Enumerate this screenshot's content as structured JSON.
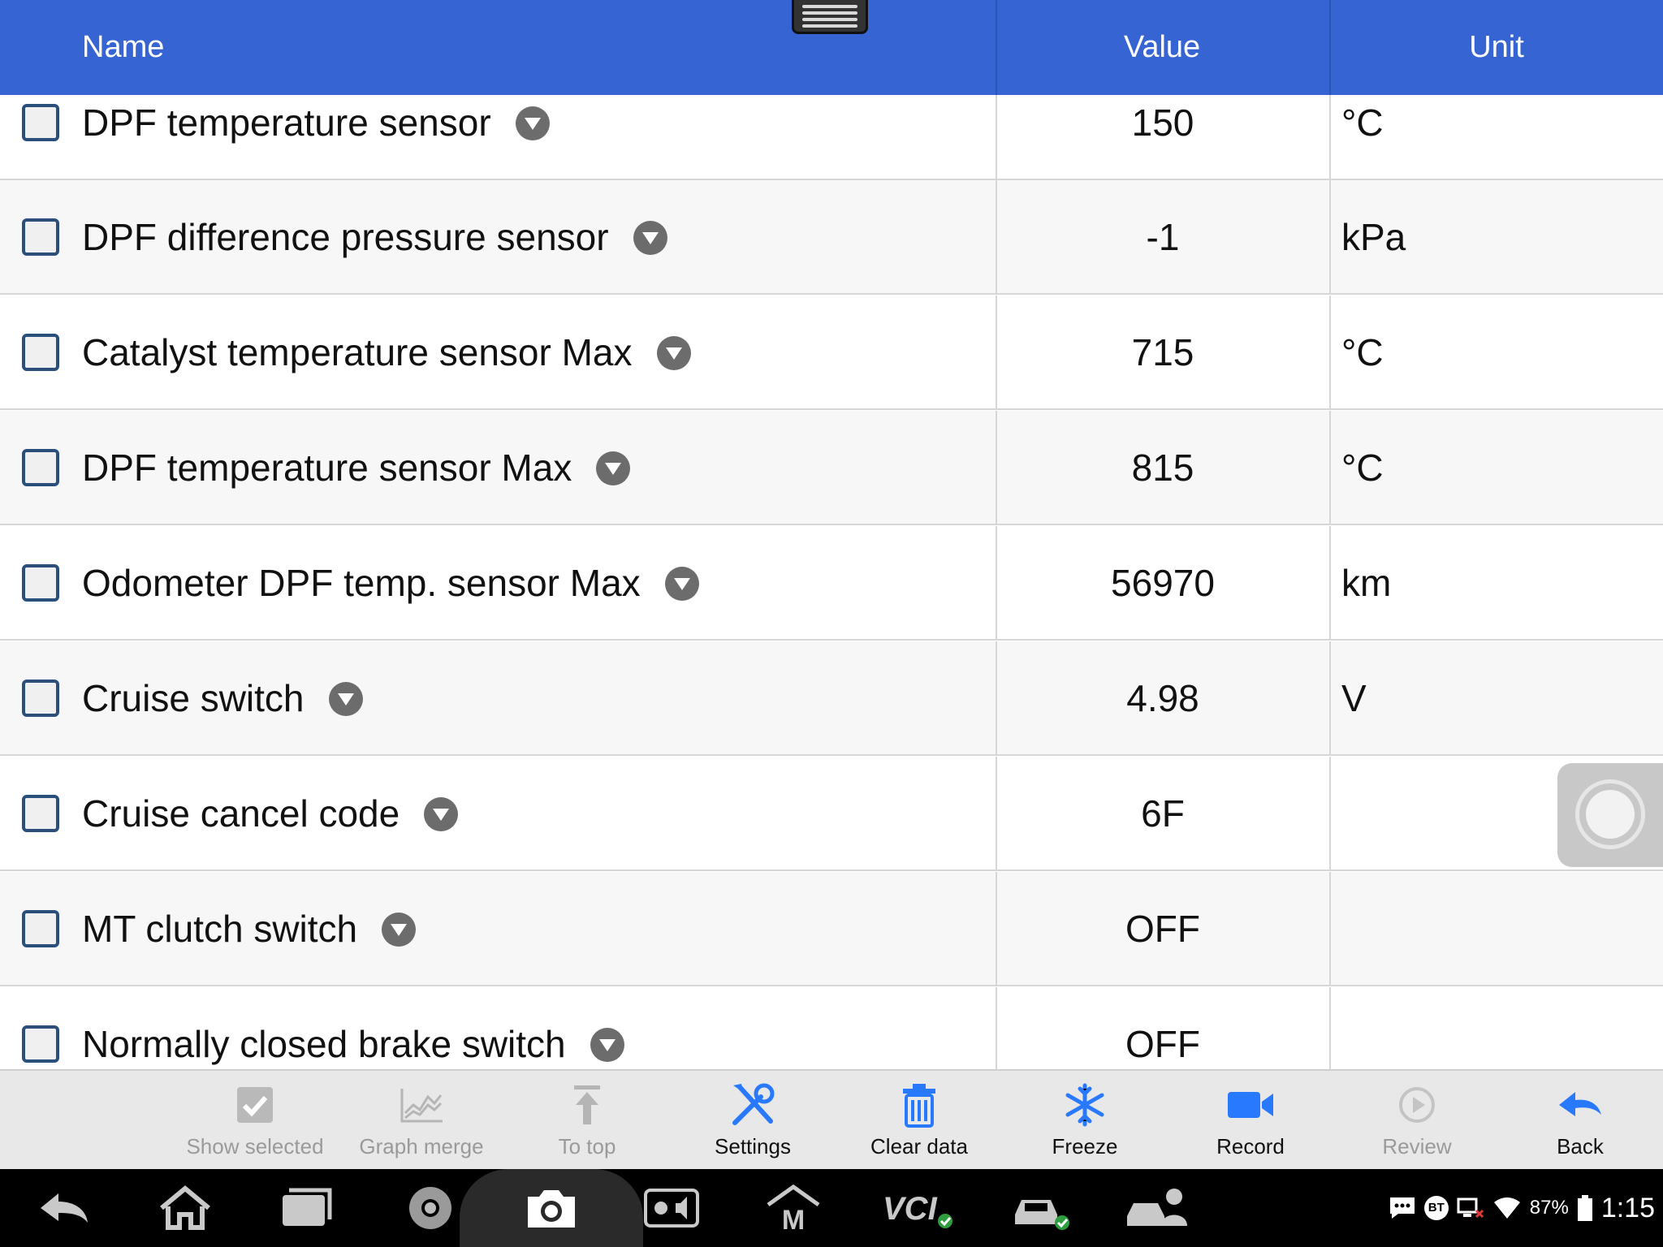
{
  "header": {
    "name": "Name",
    "value": "Value",
    "unit": "Unit"
  },
  "rows": [
    {
      "name": "DPF temperature sensor",
      "value": "150",
      "unit": "°C"
    },
    {
      "name": "DPF difference pressure sensor",
      "value": "-1",
      "unit": "kPa"
    },
    {
      "name": "Catalyst temperature sensor Max",
      "value": "715",
      "unit": "°C"
    },
    {
      "name": "DPF temperature sensor Max",
      "value": "815",
      "unit": "°C"
    },
    {
      "name": "Odometer DPF temp. sensor Max",
      "value": "56970",
      "unit": "km"
    },
    {
      "name": "Cruise switch",
      "value": "4.98",
      "unit": "V"
    },
    {
      "name": "Cruise cancel code",
      "value": "6F",
      "unit": ""
    },
    {
      "name": "MT clutch switch",
      "value": "OFF",
      "unit": ""
    },
    {
      "name": "Normally closed brake switch",
      "value": "OFF",
      "unit": ""
    }
  ],
  "toolbar": [
    {
      "label": "Show selected",
      "icon": "checkbox-icon",
      "enabled": false
    },
    {
      "label": "Graph merge",
      "icon": "graph-merge-icon",
      "enabled": false
    },
    {
      "label": "To top",
      "icon": "to-top-icon",
      "enabled": false
    },
    {
      "label": "Settings",
      "icon": "settings-tools-icon",
      "enabled": true
    },
    {
      "label": "Clear data",
      "icon": "trash-icon",
      "enabled": true
    },
    {
      "label": "Freeze",
      "icon": "snowflake-icon",
      "enabled": true
    },
    {
      "label": "Record",
      "icon": "video-camera-icon",
      "enabled": true
    },
    {
      "label": "Review",
      "icon": "play-icon",
      "enabled": false
    },
    {
      "label": "Back",
      "icon": "back-arrow-icon",
      "enabled": true
    }
  ],
  "status": {
    "bluetooth": "BT",
    "battery": "87%",
    "time": "1:15"
  },
  "colors": {
    "header": "#3664d3",
    "accent_blue": "#2979ff"
  }
}
